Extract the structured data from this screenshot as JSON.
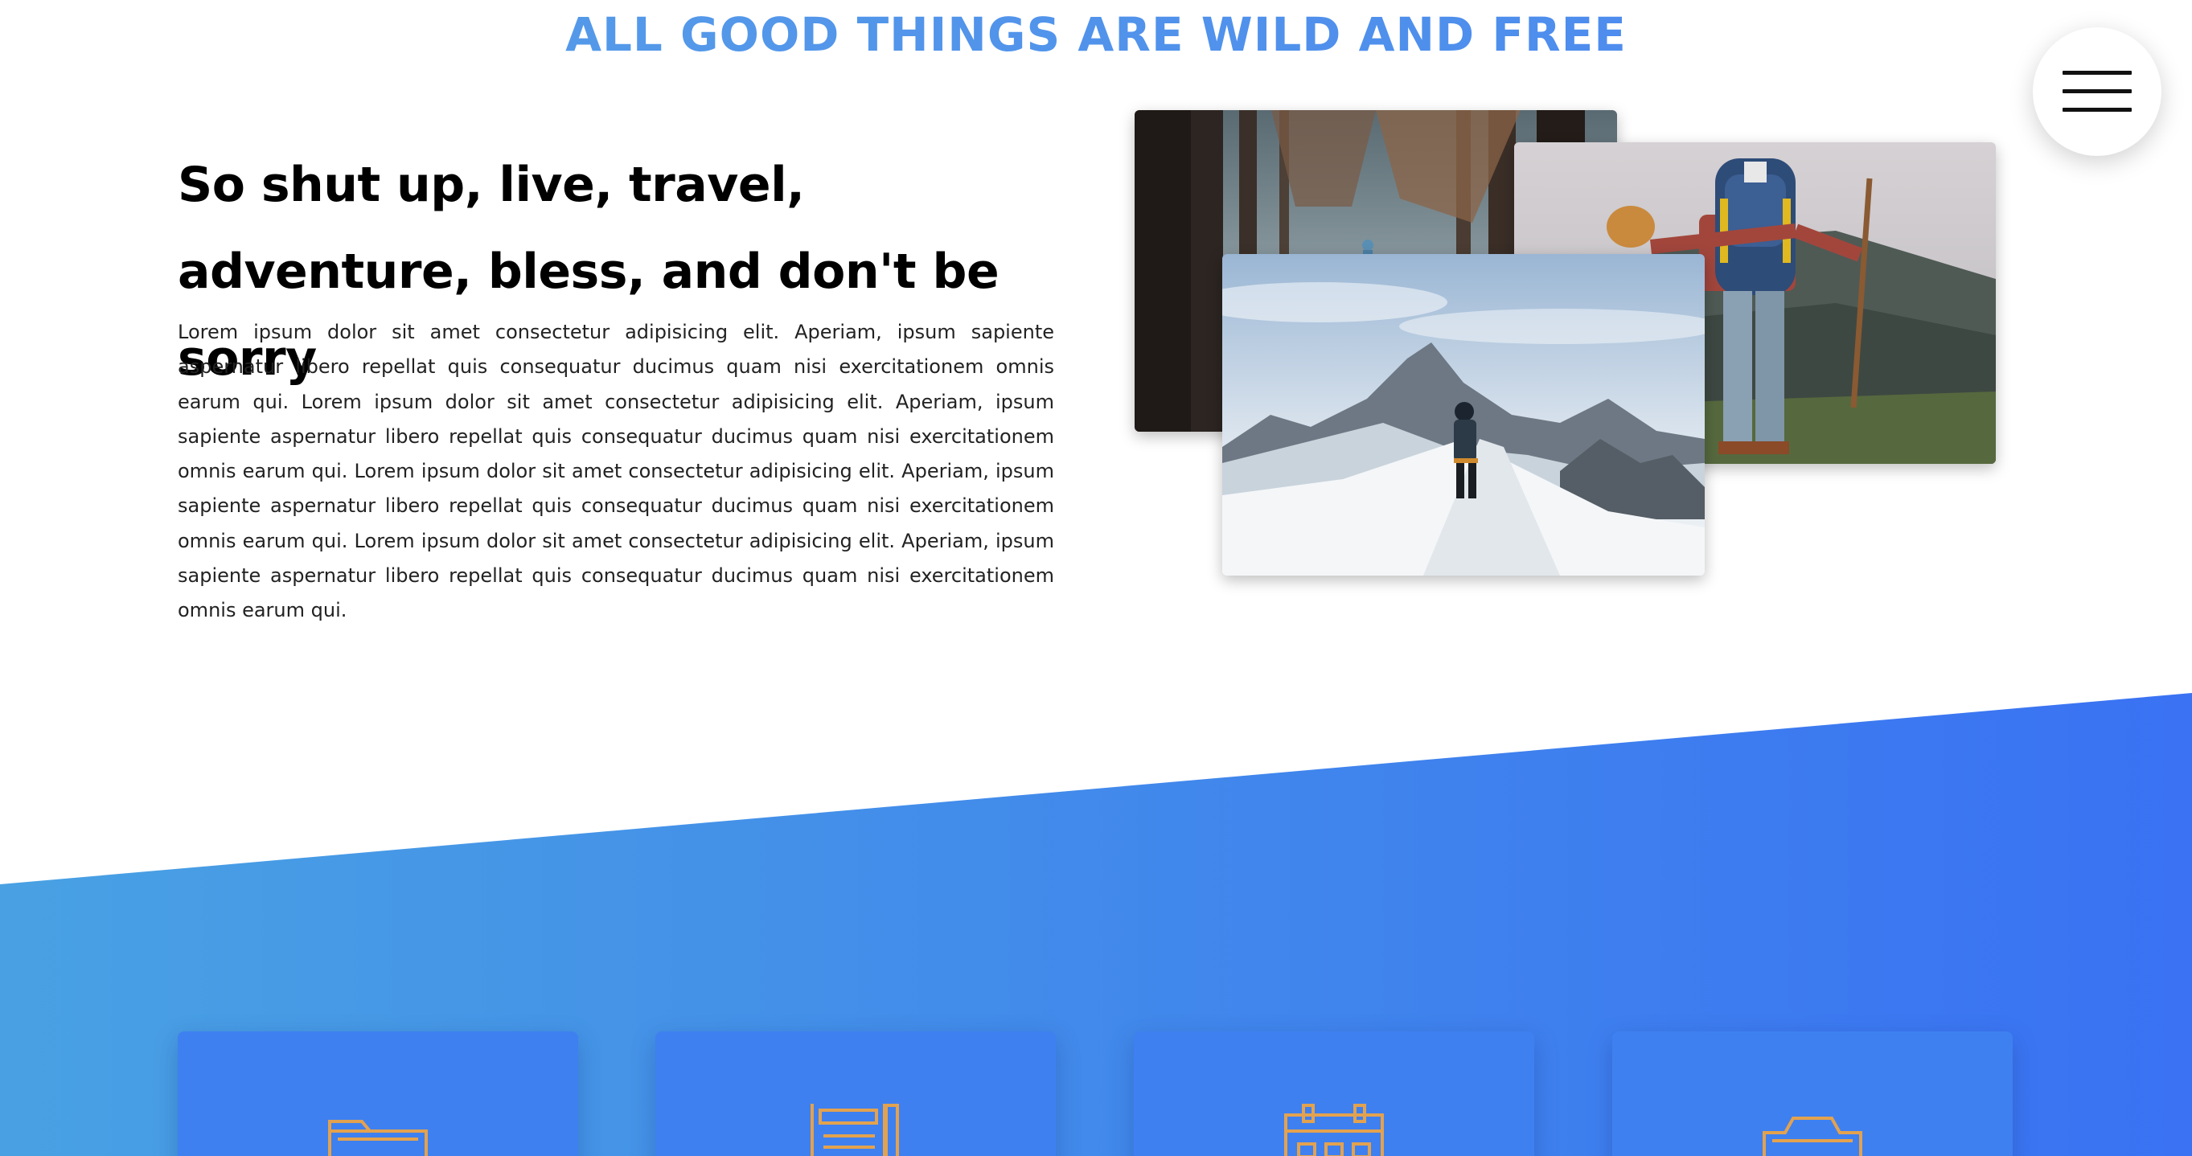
{
  "section": {
    "title": "ALL GOOD THINGS ARE WILD AND FREE"
  },
  "intro": {
    "heading": "So shut up, live, travel, adventure, bless, and don't be sorry",
    "body": "Lorem ipsum dolor sit amet consectetur adipisicing elit. Aperiam, ipsum sapiente aspernatur libero repellat quis consequatur ducimus quam nisi exercitationem omnis earum qui. Lorem ipsum dolor sit amet consectetur adipisicing elit. Aperiam, ipsum sapiente aspernatur libero repellat quis consequatur ducimus quam nisi exercitationem omnis earum qui. Lorem ipsum dolor sit amet consectetur adipisicing elit. Aperiam, ipsum sapiente aspernatur libero repellat quis consequatur ducimus quam nisi exercitationem omnis earum qui. Lorem ipsum dolor sit amet consectetur adipisicing elit. Aperiam, ipsum sapiente aspernatur libero repellat quis consequatur ducimus quam nisi exercitationem omnis earum qui."
  },
  "menu": {
    "icon": "hamburger-menu-icon"
  },
  "gallery": {
    "photos": [
      "forest-trail-photo",
      "hiker-with-backpack-photo",
      "snowy-mountain-climber-photo"
    ]
  },
  "features": {
    "cards": [
      {
        "icon": "folder-icon"
      },
      {
        "icon": "newspaper-icon"
      },
      {
        "icon": "calendar-icon"
      },
      {
        "icon": "camera-icon"
      }
    ]
  },
  "colors": {
    "title_gradient_start": "#58a0e6",
    "title_gradient_end": "#4a86f0",
    "band_gradient_start": "#49a1e3",
    "band_gradient_end": "#3a72f3",
    "card_icon": "#e3a24f"
  }
}
